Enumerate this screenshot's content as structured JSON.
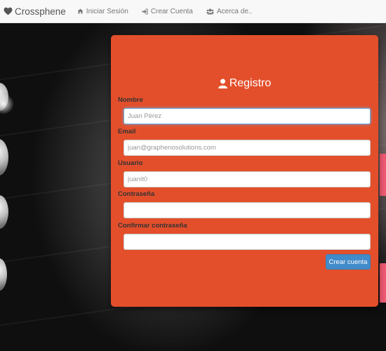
{
  "navbar": {
    "brand": {
      "label": "Crossphene",
      "icon": "heart-icon"
    },
    "links": [
      {
        "label": "Iniciar Sesión",
        "icon": "home-icon"
      },
      {
        "label": "Crear Cuenta",
        "icon": "sign-in-icon"
      },
      {
        "label": "Acerca de..",
        "icon": "users-icon"
      }
    ]
  },
  "form": {
    "title": "Registro",
    "title_icon": "user-icon",
    "fields": [
      {
        "label": "Nombre",
        "placeholder": "Juan Pérez",
        "value": ""
      },
      {
        "label": "Email",
        "placeholder": "juan@graphenosolutions.com",
        "value": ""
      },
      {
        "label": "Usuario",
        "placeholder": "juanit0",
        "value": ""
      },
      {
        "label": "Contraseña",
        "placeholder": "",
        "value": ""
      },
      {
        "label": "Confirmar contraseña",
        "placeholder": "",
        "value": ""
      }
    ],
    "submit_label": "Crear cuenta"
  },
  "colors": {
    "card": "#e34f2b",
    "navbar": "#f8f8f8",
    "button": "#428bca"
  }
}
